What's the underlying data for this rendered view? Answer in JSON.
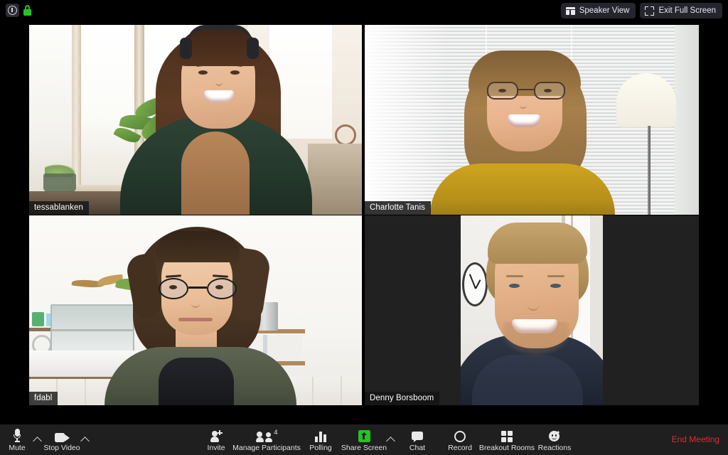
{
  "window": {
    "app": "Zoom Meeting"
  },
  "topbar": {
    "info_icon": "info-icon",
    "lock_icon": "encryption-lock-icon",
    "view_button": {
      "label": "Speaker View",
      "icon": "speaker-view-grid-icon"
    },
    "fullscreen_button": {
      "label": "Exit Full Screen",
      "icon": "exit-fullscreen-icon"
    }
  },
  "colors": {
    "active_speaker_border": "#b4e04a",
    "background": "#000000",
    "toolbar_background": "#1f1f1f",
    "end_meeting": "#e02b2b",
    "share_screen_green": "#22c522",
    "lock_green": "#22c522"
  },
  "gallery": {
    "layout": "2x2-gallery",
    "participants": [
      {
        "name": "tessablanken",
        "active_speaker": false,
        "position": "top-left",
        "video": "on"
      },
      {
        "name": "Charlotte Tanis",
        "active_speaker": true,
        "position": "top-right",
        "video": "on"
      },
      {
        "name": "fdabl",
        "active_speaker": false,
        "position": "bottom-left",
        "video": "on"
      },
      {
        "name": "Denny Borsboom",
        "active_speaker": false,
        "position": "bottom-right",
        "video": "on"
      }
    ]
  },
  "toolbar": {
    "items": [
      {
        "label": "Mute",
        "icon": "microphone-icon",
        "has_caret": true
      },
      {
        "label": "Stop Video",
        "icon": "video-camera-icon",
        "has_caret": true
      },
      {
        "label": "Invite",
        "icon": "add-person-icon",
        "has_caret": false
      },
      {
        "label": "Manage Participants",
        "icon": "people-icon",
        "has_caret": false,
        "badge": "4"
      },
      {
        "label": "Polling",
        "icon": "bar-chart-icon",
        "has_caret": false
      },
      {
        "label": "Share Screen",
        "icon": "share-screen-icon",
        "has_caret": true
      },
      {
        "label": "Chat",
        "icon": "speech-bubble-icon",
        "has_caret": false
      },
      {
        "label": "Record",
        "icon": "record-circle-icon",
        "has_caret": false
      },
      {
        "label": "Breakout Rooms",
        "icon": "four-squares-icon",
        "has_caret": false
      },
      {
        "label": "Reactions",
        "icon": "smiley-sparkle-icon",
        "has_caret": false
      }
    ],
    "end_meeting_label": "End Meeting"
  }
}
